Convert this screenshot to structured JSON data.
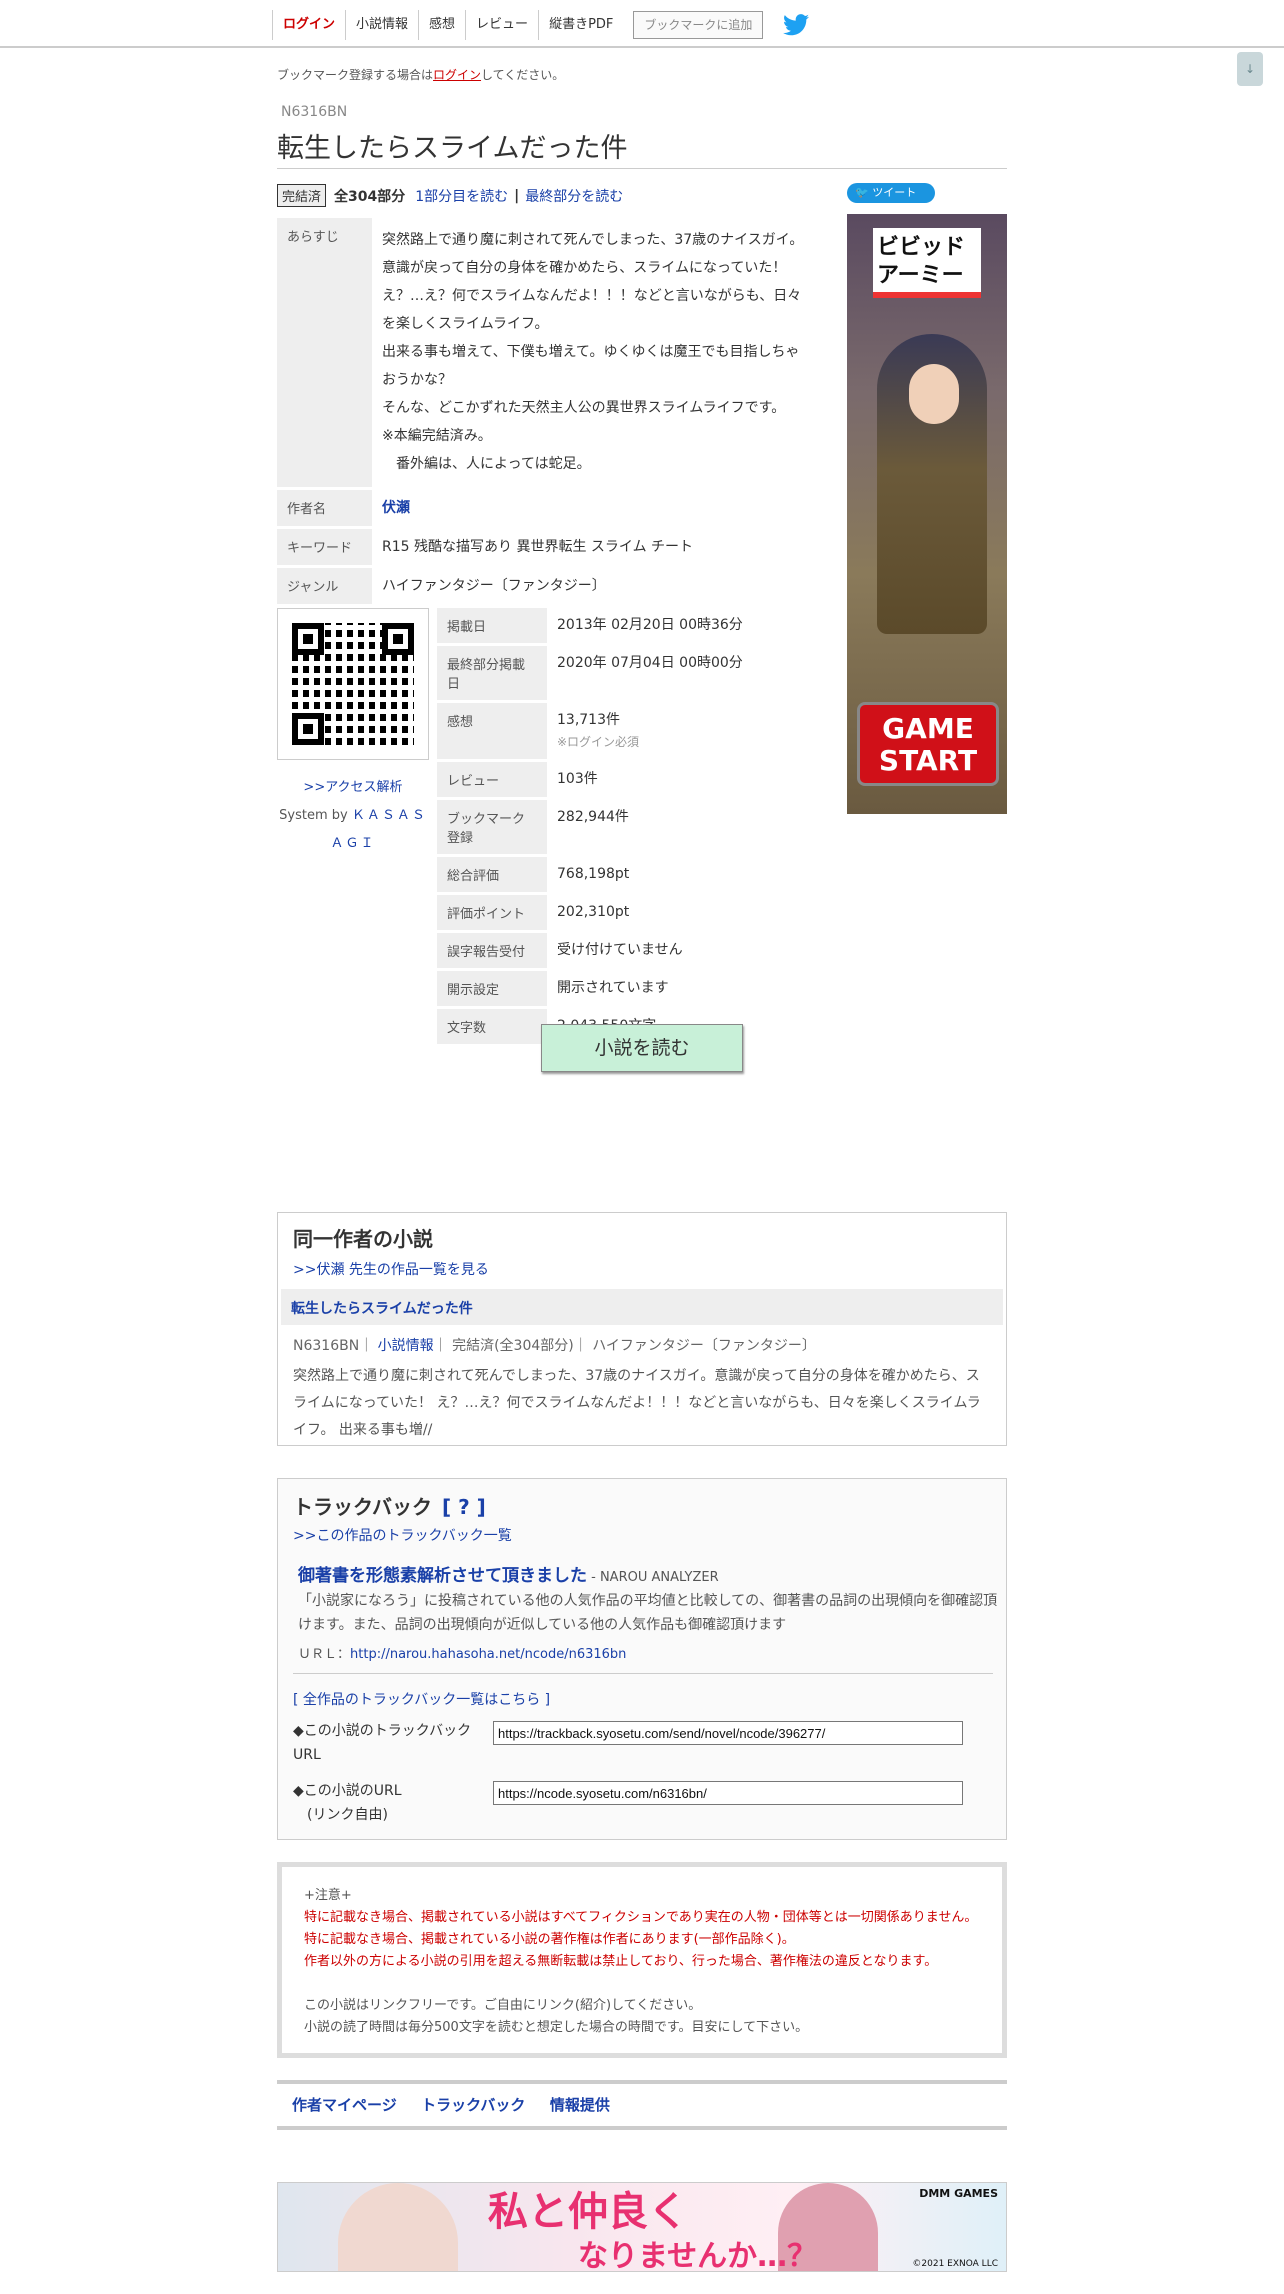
{
  "header": {
    "nav": [
      "ログイン",
      "小説情報",
      "感想",
      "レビュー",
      "縦書きPDF"
    ],
    "bookmark": "ブックマークに追加"
  },
  "scroll": "↓",
  "note": {
    "pre": "ブックマーク登録する場合は",
    "link": "ログイン",
    "post": "してください。"
  },
  "novel": {
    "ncode": "N6316BN",
    "title": "転生したらスライムだった件",
    "status": "完結済",
    "count": "全304部分",
    "first": "1部分目を読む",
    "sep": "|",
    "last": "最終部分を読む"
  },
  "tweet": "ツイート",
  "ad_side": {
    "logo": "ビビッド\nアーミー",
    "cta": "GAME\nSTART"
  },
  "info": {
    "synopsis_label": "あらすじ",
    "synopsis": [
      "突然路上で通り魔に刺されて死んでしまった、37歳のナイスガイ。",
      "意識が戻って自分の身体を確かめたら、スライムになっていた！",
      "え？…え？何でスライムなんだよ！！！などと言いながらも、日々を楽しくスライムライフ。",
      "出来る事も増えて、下僕も増えて。ゆくゆくは魔王でも目指しちゃおうかな？",
      "そんな、どこかずれた天然主人公の異世界スライムライフです。",
      "※本編完結済み。",
      "　番外編は、人によっては蛇足。"
    ],
    "author_label": "作者名",
    "author": "伏瀬",
    "keyword_label": "キーワード",
    "keywords": "R15 残酷な描写あり 異世界転生 スライム チート",
    "genre_label": "ジャンル",
    "genre": "ハイファンタジー〔ファンタジー〕"
  },
  "qr_side": {
    "access": ">>アクセス解析",
    "system": "System by",
    "kasasagi": "ＫＡＳＡＳＡＧＩ"
  },
  "stats": [
    {
      "label": "掲載日",
      "value": "2013年 02月20日 00時36分"
    },
    {
      "label": "最終部分掲載日",
      "value": "2020年 07月04日 00時00分"
    },
    {
      "label": "感想",
      "value": "13,713件",
      "sub": "※ログイン必須"
    },
    {
      "label": "レビュー",
      "value": "103件"
    },
    {
      "label": "ブックマーク登録",
      "value": "282,944件"
    },
    {
      "label": "総合評価",
      "value": "768,198pt"
    },
    {
      "label": "評価ポイント",
      "value": "202,310pt"
    },
    {
      "label": "誤字報告受付",
      "value": "受け付けていません"
    },
    {
      "label": "開示設定",
      "value": "開示されています"
    },
    {
      "label": "文字数",
      "value": "2,043,550文字"
    }
  ],
  "read_button": "小説を読む",
  "same_author": {
    "heading": "同一作者の小説",
    "more": ">>伏瀬 先生の作品一覧を見る",
    "item_title": "転生したらスライムだった件",
    "meta_ncode": "N6316BN",
    "meta_info": "小説情報",
    "meta_rest": "完結済(全304部分)",
    "meta_genre": "ハイファンタジー〔ファンタジー〕",
    "desc": "突然路上で通り魔に刺されて死んでしまった、37歳のナイスガイ。意識が戻って自分の身体を確かめたら、スライムになっていた！ え？…え？何でスライムなんだよ！！！などと言いながらも、日々を楽しくスライムライフ。 出来る事も増//"
  },
  "trackback": {
    "heading": "トラックバック",
    "q": "[ ? ]",
    "list": ">>この作品のトラックバック一覧",
    "entry_title": "御著書を形態素解析させて頂きました",
    "entry_src": " - NAROU ANALYZER",
    "entry_desc": "「小説家になろう」に投稿されている他の人気作品の平均値と比較しての、御著書の品詞の出現傾向を御確認頂けます。また、品詞の出現傾向が近似している他の人気作品も御確認頂けます",
    "url_label": "ＵＲＬ：",
    "url": "http://narou.hahasoha.net/ncode/n6316bn",
    "all": "[ 全作品のトラックバック一覧はこちら ]",
    "tb_label": "◆この小説のトラックバックURL",
    "tb_value": "https://trackback.syosetu.com/send/novel/ncode/396277/",
    "url_label2": "◆この小説のURL\n　(リンク自由)",
    "url_value": "https://ncode.syosetu.com/n6316bn/"
  },
  "notice": {
    "head": "+注意+",
    "red": [
      "特に記載なき場合、掲載されている小説はすべてフィクションであり実在の人物・団体等とは一切関係ありません。",
      "特に記載なき場合、掲載されている小説の著作権は作者にあります(一部作品除く)。",
      "作者以外の方による小説の引用を超える無断転載は禁止しており、行った場合、著作権法の違反となります。"
    ],
    "gray": [
      "この小説はリンクフリーです。ご自由にリンク(紹介)してください。",
      "小説の読了時間は毎分500文字を読むと想定した場合の時間です。目安にして下さい。"
    ]
  },
  "footnav": [
    "作者マイページ",
    "トラックバック",
    "情報提供"
  ],
  "ad_bottom": {
    "line1": "私と仲良く",
    "line2": "なりませんか…？",
    "brand": "DMM GAMES",
    "copy": "©2021 EXNOA LLC"
  }
}
